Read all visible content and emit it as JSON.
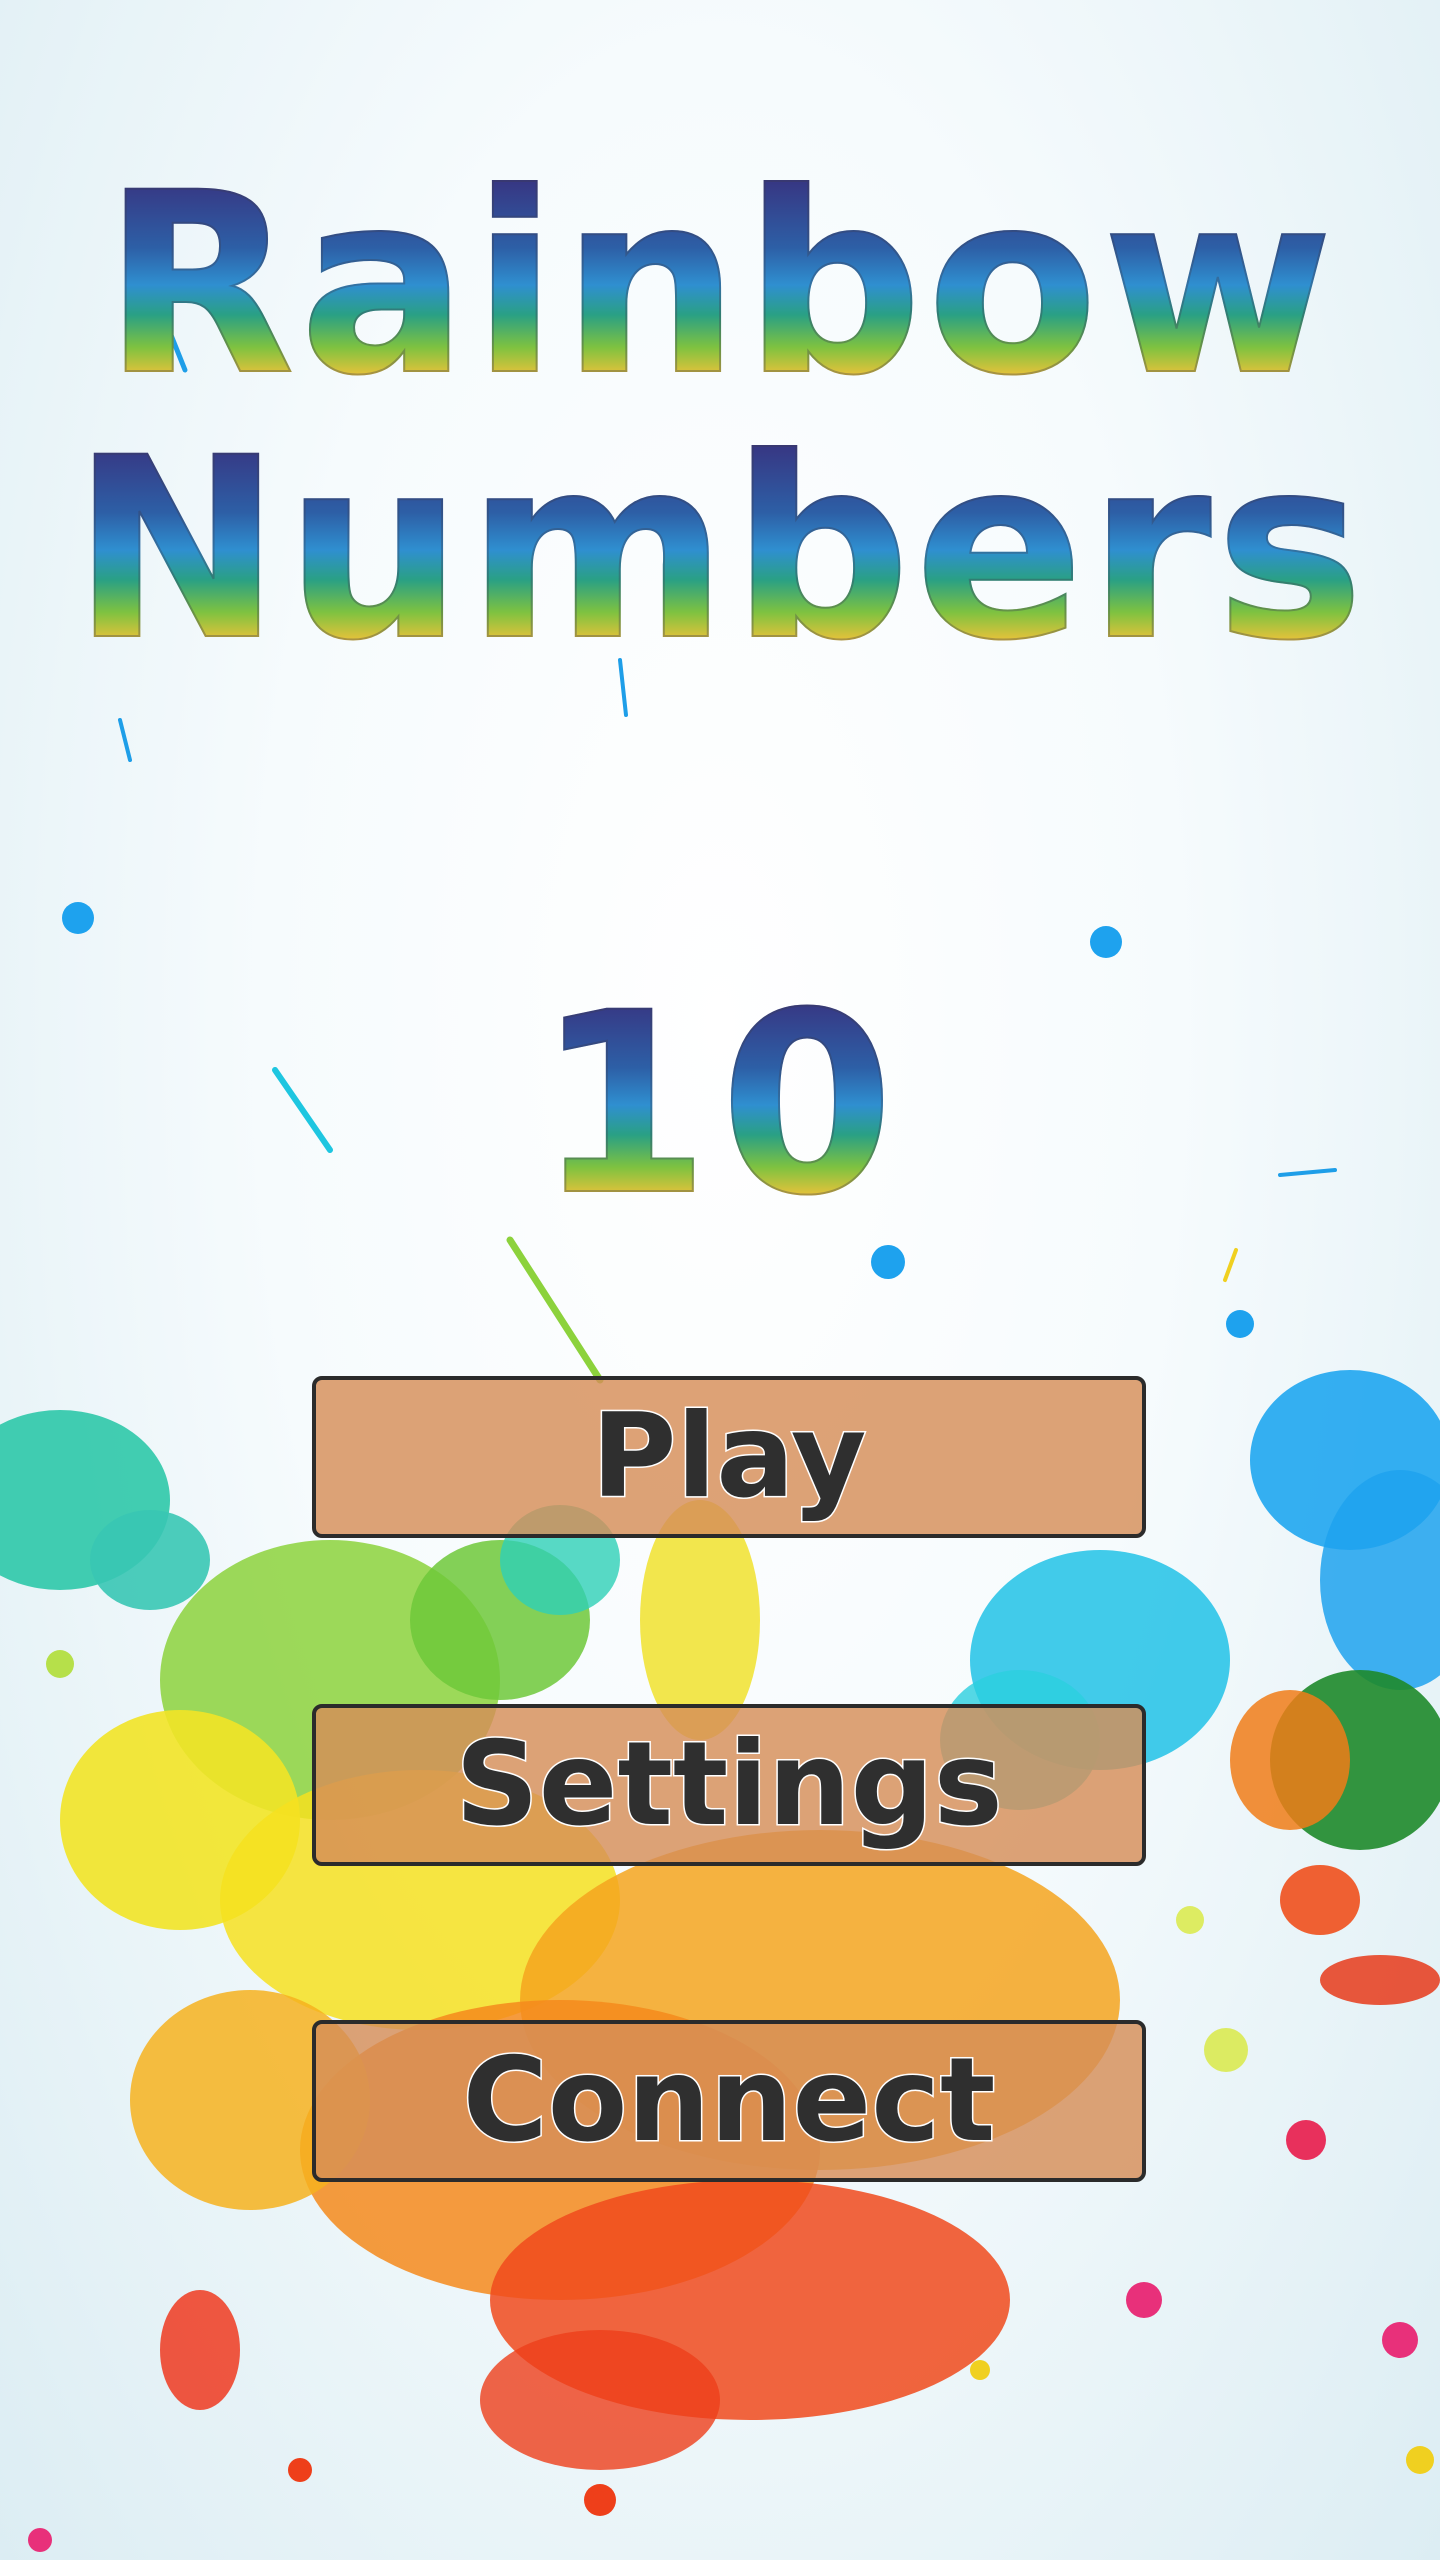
{
  "title": {
    "line1": "Rainbow",
    "line2": "Numbers"
  },
  "score": "10",
  "menu": {
    "play_label": "Play",
    "settings_label": "Settings",
    "connect_label": "Connect"
  },
  "colors": {
    "button_fill": "#d68e58",
    "button_border": "#2b2b2b",
    "button_text": "#2f2f2f",
    "rainbow": [
      "#3a2a78",
      "#2d5fa6",
      "#2f8fd0",
      "#2aa084",
      "#7fc240",
      "#e6c23a",
      "#e2623d"
    ]
  }
}
